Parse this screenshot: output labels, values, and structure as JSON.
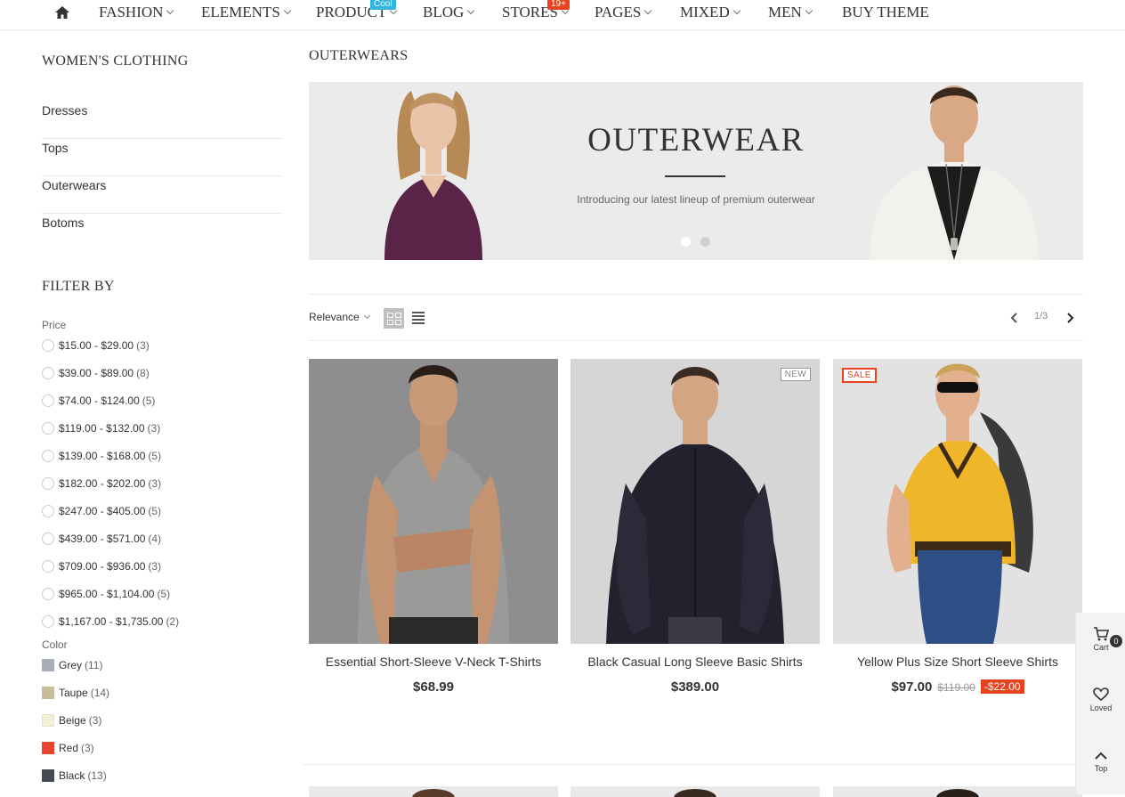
{
  "nav": {
    "items": [
      {
        "label": "FASHION"
      },
      {
        "label": "ELEMENTS"
      },
      {
        "label": "PRODUCT",
        "badge": "Cool"
      },
      {
        "label": "BLOG"
      },
      {
        "label": "STORES",
        "badge": "19+"
      },
      {
        "label": "PAGES"
      },
      {
        "label": "MIXED"
      },
      {
        "label": "MEN"
      },
      {
        "label": "BUY THEME"
      }
    ],
    "home_icon": "home-icon"
  },
  "sidebar": {
    "category_title": "WOMEN'S CLOTHING",
    "categories": [
      "Dresses",
      "Tops",
      "Outerwears",
      "Botoms"
    ],
    "filter_title": "FILTER BY",
    "price_label": "Price",
    "prices": [
      {
        "range": "$15.00 - $29.00",
        "count": "(3)"
      },
      {
        "range": "$39.00 - $89.00",
        "count": "(8)"
      },
      {
        "range": "$74.00 - $124.00",
        "count": "(5)"
      },
      {
        "range": "$119.00 - $132.00",
        "count": "(3)"
      },
      {
        "range": "$139.00 - $168.00",
        "count": "(5)"
      },
      {
        "range": "$182.00 - $202.00",
        "count": "(3)"
      },
      {
        "range": "$247.00 - $405.00",
        "count": "(5)"
      },
      {
        "range": "$439.00 - $571.00",
        "count": "(4)"
      },
      {
        "range": "$709.00 - $936.00",
        "count": "(3)"
      },
      {
        "range": "$965.00 - $1,104.00",
        "count": "(5)"
      },
      {
        "range": "$1,167.00 - $1,735.00",
        "count": "(2)"
      }
    ],
    "color_label": "Color",
    "colors": [
      {
        "name": "Grey",
        "count": "(11)",
        "hex": "#a9aeb8"
      },
      {
        "name": "Taupe",
        "count": "(14)",
        "hex": "#c8bc9c"
      },
      {
        "name": "Beige",
        "count": "(3)",
        "hex": "#f4f0d8"
      },
      {
        "name": "Red",
        "count": "(3)",
        "hex": "#e8432e"
      },
      {
        "name": "Black",
        "count": "(13)",
        "hex": "#444a55"
      }
    ]
  },
  "main": {
    "title": "OUTERWEARS",
    "banner": {
      "title": "OUTERWEAR",
      "subtitle": "Introducing our latest lineup of premium outerwear"
    },
    "toolbar": {
      "sort_label": "Relevance",
      "page_indicator": "1/3"
    },
    "products": [
      {
        "name": "Essential Short-Sleeve V-Neck T-Shirts",
        "price": "$68.99",
        "tag": ""
      },
      {
        "name": "Black Casual Long Sleeve Basic Shirts",
        "price": "$389.00",
        "tag": "NEW"
      },
      {
        "name": "Yellow Plus Size Short Sleeve Shirts",
        "price": "$97.00",
        "old_price": "$119.00",
        "discount": "-$22.00",
        "tag": "SALE"
      }
    ]
  },
  "floatbar": {
    "cart_label": "Cart",
    "cart_count": "0",
    "loved_label": "Loved",
    "top_label": "Top"
  },
  "colors": {
    "accent_red": "#e8431e",
    "accent_blue": "#2fb5e0"
  }
}
